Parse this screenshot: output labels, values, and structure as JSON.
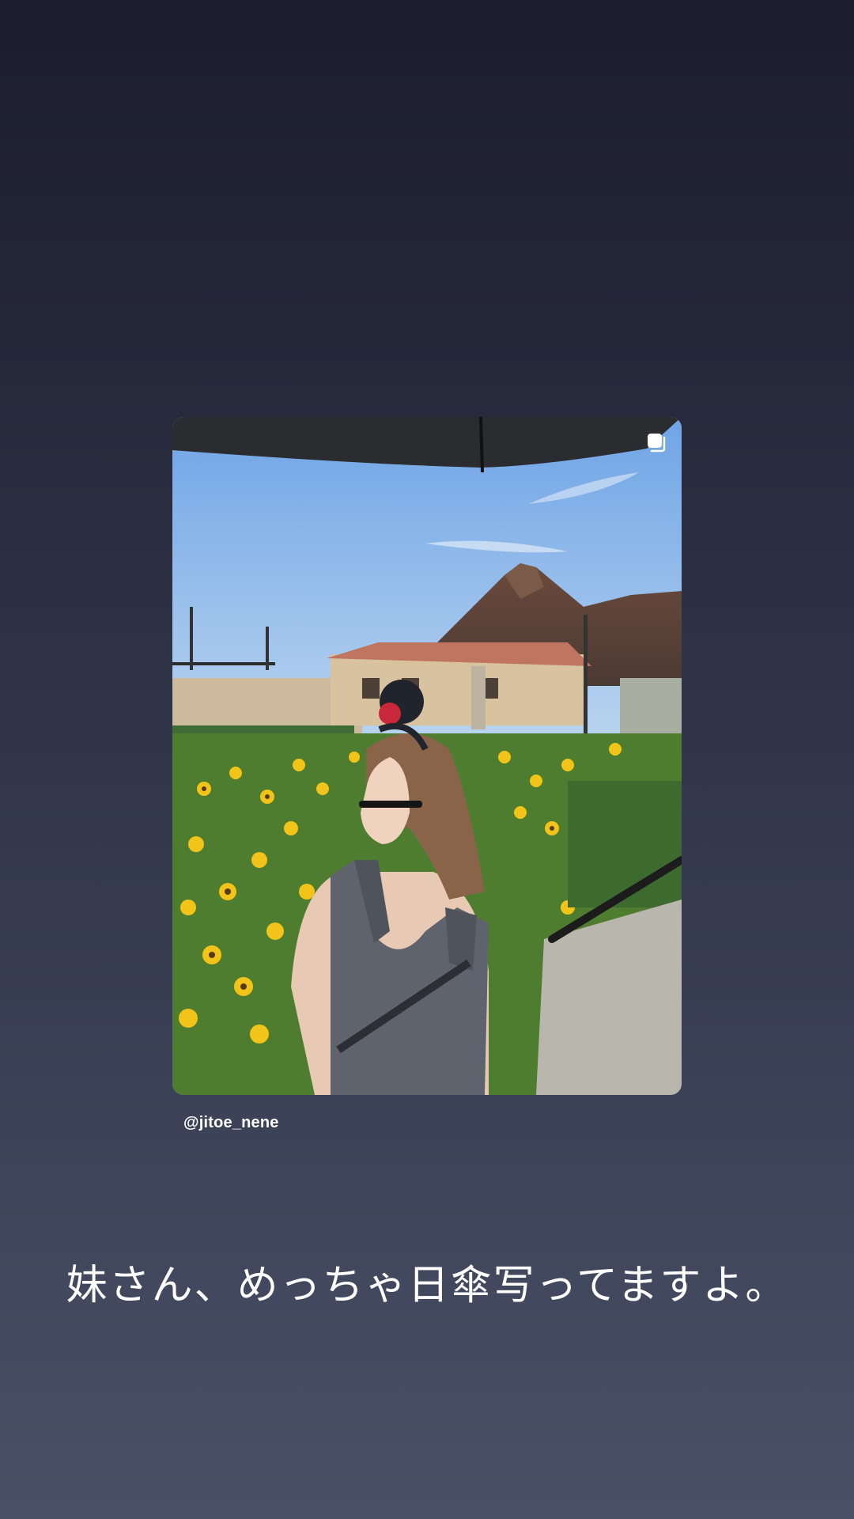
{
  "story": {
    "background_top": "#1b1d2d",
    "background_bottom": "#4a5166"
  },
  "post": {
    "username": "@jitoe_nene",
    "multi_image_icon": "carousel-icon",
    "photo_subject": "photo-of-woman-in-sunflower-garden"
  },
  "caption": {
    "text": "妹さん、めっちゃ日傘写ってますよ。"
  }
}
